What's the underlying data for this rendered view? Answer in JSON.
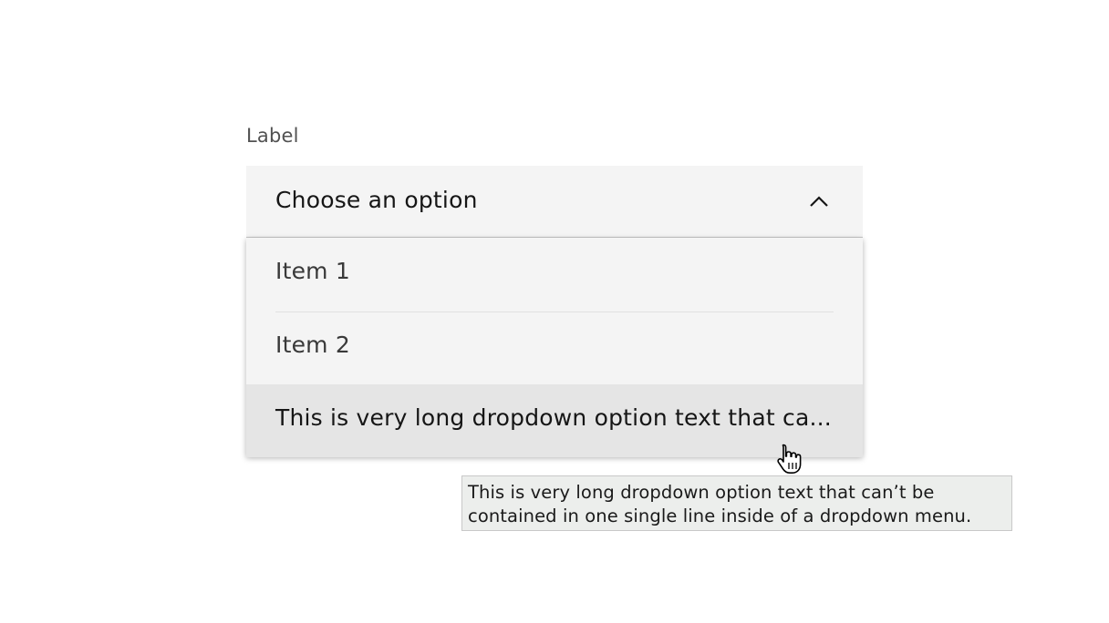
{
  "dropdown": {
    "label": "Label",
    "placeholder": "Choose an option",
    "expanded": true,
    "items": [
      {
        "label": "Item 1"
      },
      {
        "label": "Item 2"
      },
      {
        "label": "This is very long dropdown option text that ca..."
      }
    ],
    "hovered_item_index": 2
  },
  "tooltip": {
    "line1": "This is very long dropdown option text that can’t be",
    "line2": "contained in one single line inside of a dropdown menu."
  },
  "icons": {
    "chevron": "chevron-up-icon",
    "cursor": "hand-pointer-cursor"
  },
  "colors": {
    "field_background": "#f4f4f4",
    "hover_background": "#e5e5e5",
    "tooltip_background": "#eceeec",
    "text_primary": "#161616",
    "text_secondary": "#525252"
  }
}
